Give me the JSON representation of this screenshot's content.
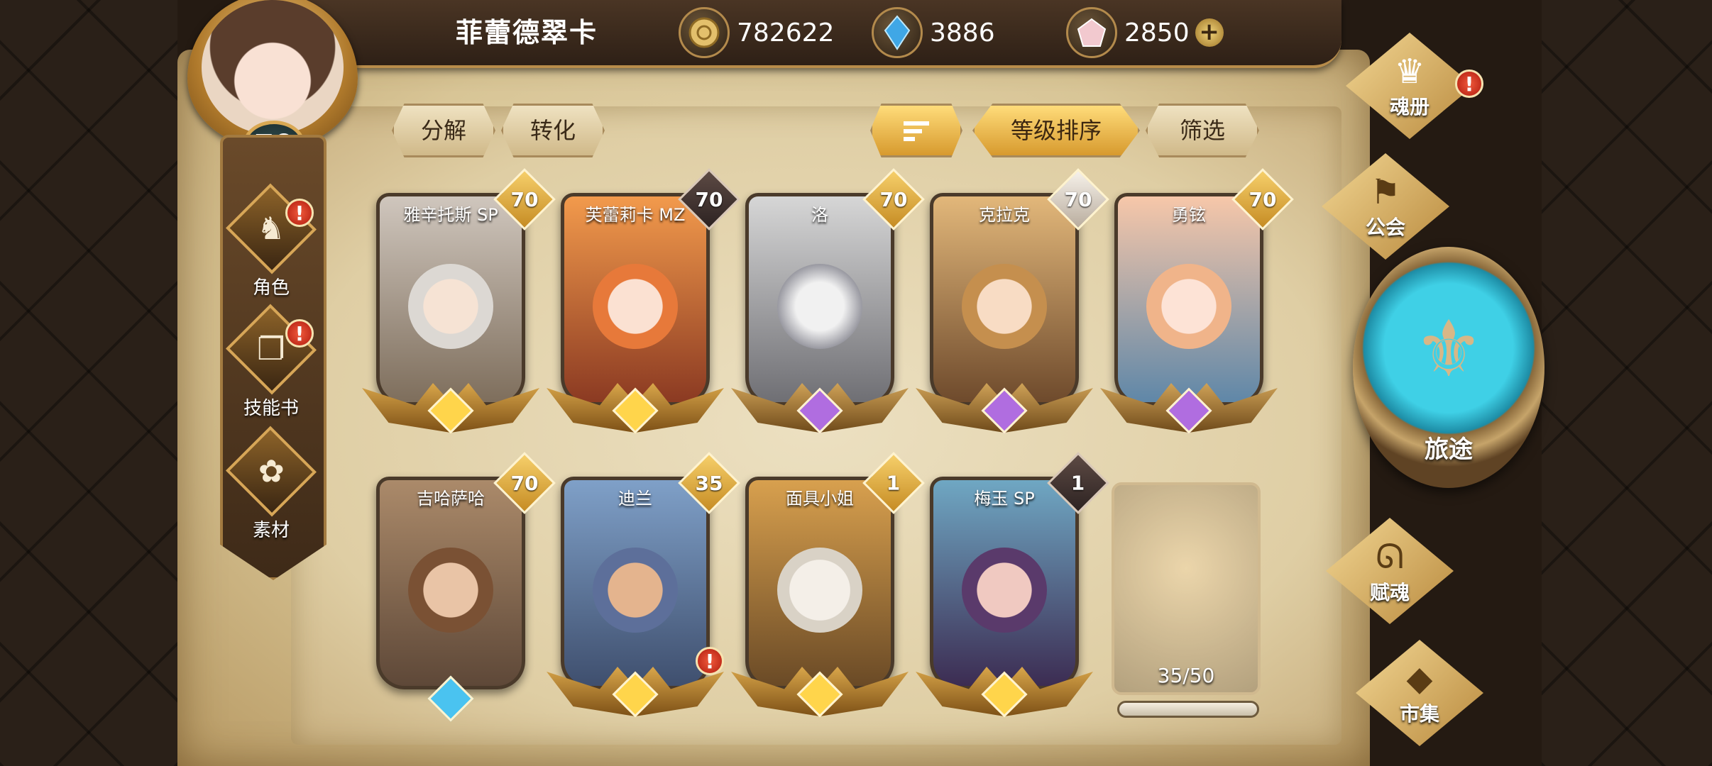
{
  "player": {
    "name": "菲蕾德翠卡",
    "level": "70"
  },
  "resources": {
    "gold": "782622",
    "crystal": "3886",
    "gem": "2850",
    "add_symbol": "+"
  },
  "side_menu": [
    {
      "label": "角色",
      "alert": "!"
    },
    {
      "label": "技能书",
      "alert": "!"
    },
    {
      "label": "素材"
    }
  ],
  "toolbar": {
    "decompose": "分解",
    "convert": "转化",
    "sort_order": "等级排序",
    "filter": "筛选"
  },
  "cards": [
    {
      "name": "雅辛托斯 SP",
      "level": "70",
      "rarity": "gold"
    },
    {
      "name": "芙蕾莉卡 MZ",
      "level": "70",
      "rarity": "gold"
    },
    {
      "name": "洛",
      "level": "70",
      "rarity": "purple"
    },
    {
      "name": "克拉克",
      "level": "70",
      "rarity": "purple"
    },
    {
      "name": "勇铉",
      "level": "70",
      "rarity": "purple"
    },
    {
      "name": "吉哈萨哈",
      "level": "70",
      "rarity": "blue"
    },
    {
      "name": "迪兰",
      "level": "35",
      "rarity": "gold",
      "alert": "!"
    },
    {
      "name": "面具小姐",
      "level": "1",
      "rarity": "gold"
    },
    {
      "name": "梅玉 SP",
      "level": "1",
      "rarity": "gold"
    }
  ],
  "slots": {
    "count": "35/50"
  },
  "right_menu": {
    "soul_book": "魂册",
    "soul_book_alert": "!",
    "guild": "公会",
    "journey": "旅途",
    "endow": "赋魂",
    "market": "市集"
  },
  "colors": {
    "accent_gold": "#d79a2e",
    "alert_red": "#d63420",
    "parchment": "#e7d8b4",
    "journey_teal": "#3fd0e6"
  },
  "icons": {
    "gold": "gold-coin-icon",
    "crystal": "blue-crystal-icon",
    "gem": "pink-gem-icon",
    "sort": "sort-lines-icon"
  }
}
